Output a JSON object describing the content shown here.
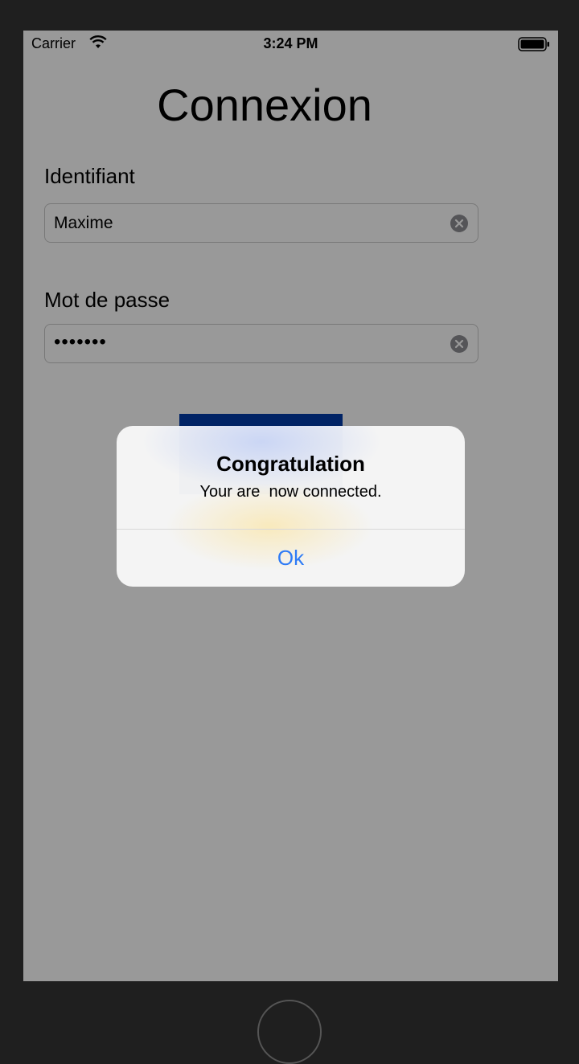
{
  "status_bar": {
    "carrier": "Carrier",
    "time": "3:24 PM",
    "wifi_icon": "wifi-icon",
    "battery_icon": "battery-icon"
  },
  "page": {
    "title": "Connexion"
  },
  "form": {
    "username_label": "Identifiant",
    "username_value": "Maxime",
    "password_label": "Mot de passe",
    "password_value": "•••••••",
    "clear_icon": "clear-icon",
    "login_button_color": "#003ba8"
  },
  "alert": {
    "title": "Congratulation",
    "message": "Your are  now connected.",
    "ok_label": "Ok",
    "ok_color": "#2e7bf6"
  }
}
